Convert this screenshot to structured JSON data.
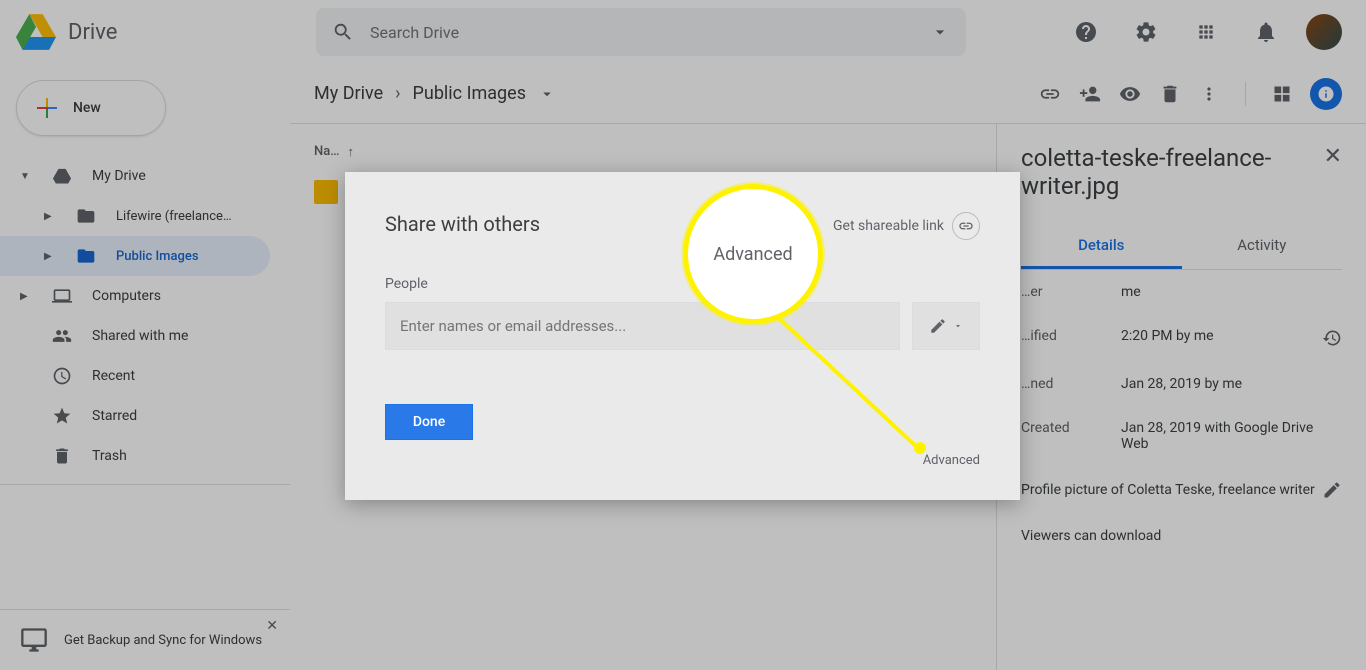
{
  "header": {
    "title": "Drive",
    "search_placeholder": "Search Drive"
  },
  "sidebar": {
    "new_label": "New",
    "items": [
      {
        "label": "My Drive"
      },
      {
        "label": "Lifewire (freelance…"
      },
      {
        "label": "Public Images"
      },
      {
        "label": "Computers"
      },
      {
        "label": "Shared with me"
      },
      {
        "label": "Recent"
      },
      {
        "label": "Starred"
      },
      {
        "label": "Trash"
      }
    ],
    "backup_promo": "Get Backup and Sync for Windows"
  },
  "breadcrumb": {
    "root": "My Drive",
    "folder": "Public Images"
  },
  "columns": {
    "name": "Na…"
  },
  "details": {
    "filename": "coletta-teske-freelance-writer.jpg",
    "tab_details": "Details",
    "tab_activity": "Activity",
    "rows": [
      {
        "label": "…er",
        "value": "me"
      },
      {
        "label": "…ified",
        "value": "2:20 PM by me"
      },
      {
        "label": "…ned",
        "value": "Jan 28, 2019 by me"
      },
      {
        "label": "Created",
        "value": "Jan 28, 2019 with Google Drive Web"
      }
    ],
    "description": "Profile picture of Coletta Teske, freelance writer",
    "download_note": "Viewers can download"
  },
  "modal": {
    "title": "Share with others",
    "shareable_link": "Get shareable link",
    "people_label": "People",
    "people_placeholder": "Enter names or email addresses...",
    "done": "Done",
    "advanced": "Advanced"
  },
  "highlight": {
    "label": "Advanced"
  }
}
